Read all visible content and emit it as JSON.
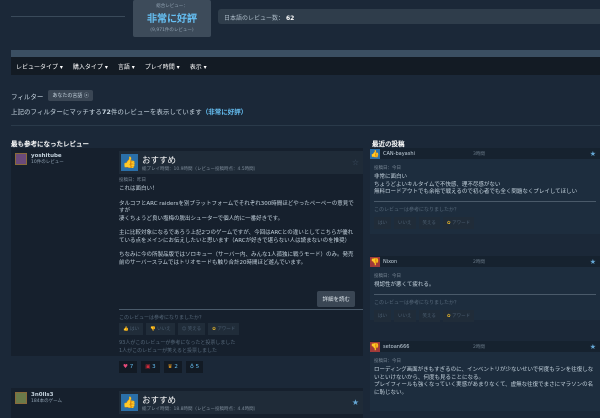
{
  "summary": {
    "label": "総合レビュー：",
    "rating": "非常に好評",
    "count": "(9,971件のレビュー)"
  },
  "jp_reviews": {
    "label": "日本語のレビュー数：",
    "value": "62"
  },
  "nav": [
    "レビュータイプ ▾",
    "購入タイプ ▾",
    "言語 ▾",
    "プレイ時間 ▾",
    "表示 ▾"
  ],
  "filter": {
    "label": "フィルター",
    "chip": "あなたの言語 ⓧ"
  },
  "match": {
    "prefix": "上記のフィルターにマッチする",
    "count": "72",
    "suffix": "件のレビューを表示しています",
    "rating": "（非常に好評）"
  },
  "left": {
    "heading": "最も参考になったレビュー",
    "review": {
      "user": "yoshitube",
      "user_sub": "10件のレビュー",
      "verdict": "おすすめ",
      "playtime": "総プレイ時間：10.9時間（レビュー投稿時点：4.5時間）",
      "posted": "投稿日：昨日",
      "paragraphs": [
        "これは面白い！",
        "タルコフとARC raidersを別プラットフォームでそれぞれ300時間ほどやったペーペーの意見ですが\n凄くちょうど良い塩梅の脱出シューターで個人的に一番好きです。",
        "主に比較対象になるであろう上記2つのゲームですが、今回はARCとの違いとしてこちらが優れている点をメインにお伝えしたいと思います（ARCが好きで堪らない人は読まないのを推奨）",
        "ちなみに今の所製品版ではソロキュー（サーバー内、みんな1人孤独に戦うモード）のみ。発売前のサーバースラムではトリオモードも触り合計20時間ほど遊んでいます。"
      ],
      "read_more": "詳細を読む",
      "helpful_q": "このレビューは参考になりましたか？",
      "votes": [
        "👍 はい",
        "👎 いいえ",
        "☺ 笑える",
        "アワード"
      ],
      "stats": [
        "93人がこのレビューが参考になったと投票しました",
        "1人がこのレビューが笑えると投票しました"
      ],
      "awards": [
        {
          "icon": "heart-icon",
          "count": "7"
        },
        {
          "icon": "gift-icon",
          "count": "3"
        },
        {
          "icon": "trophy-icon",
          "count": "2"
        },
        {
          "icon": "medal-icon",
          "count": "5"
        }
      ]
    },
    "review2": {
      "user": "3n0lls3",
      "user_sub": "184本のゲーム",
      "verdict": "おすすめ",
      "playtime": "総プレイ時間：18.8時間（レビュー投稿時点：4.4時間）"
    }
  },
  "right": {
    "heading": "最近の投稿",
    "posts": [
      {
        "user": "CAN-bayashi",
        "time": "3時間",
        "positive": true,
        "posted": "投稿日：今日",
        "text": "非常に面白い\nちょうどよいキルタイムで不快感、理不尽感がない\n無料ロードアウトでも余裕で戦えるので初心者でも全く問題なくプレイしてほしい",
        "helpful_q": "このレビューは参考になりましたか？",
        "votes": [
          "はい",
          "いいえ",
          "笑える",
          "アワード"
        ]
      },
      {
        "user": "Nixon",
        "time": "2時間",
        "positive": false,
        "posted": "投稿日：今日",
        "text": "視認性が悪くて疲れる。",
        "helpful_q": "このレビューは参考になりましたか？",
        "votes": [
          "はい",
          "いいえ",
          "笑える",
          "アワード"
        ]
      },
      {
        "user": "setoan666",
        "time": "2時間",
        "positive": false,
        "posted": "投稿日：今日",
        "text": "ローディング画面がきもすぎるのに、インベントリが少ないせいで何度もランを往復しないといけないから、何度も見ることになる。\nプレイフィールも強くなっていく実感があまりなくて、虚無な往復でまさにマラソンの名に恥じない。"
      }
    ]
  }
}
